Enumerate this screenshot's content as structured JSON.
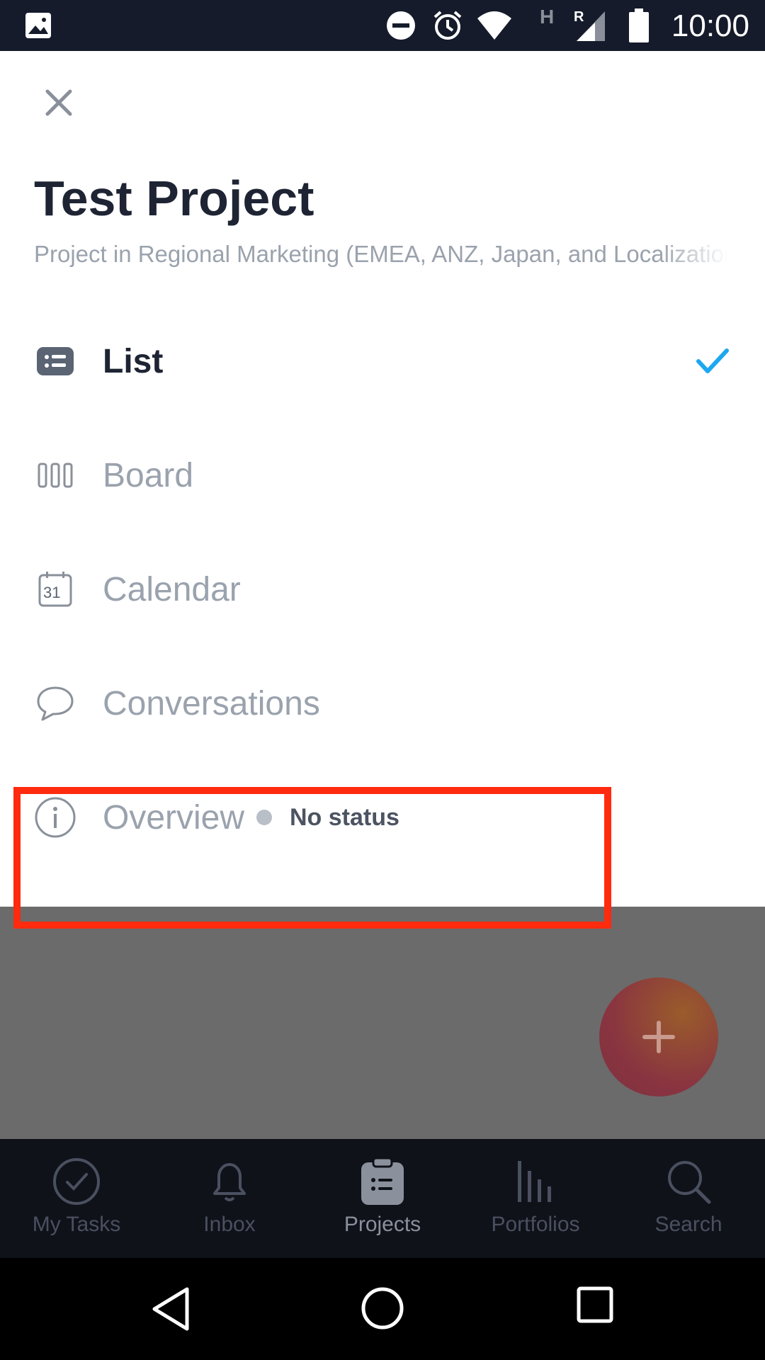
{
  "status_bar": {
    "time": "10:00"
  },
  "sheet": {
    "title": "Test Project",
    "subtitle": "Project in Regional Marketing (EMEA, ANZ, Japan, and Localization)",
    "menu": [
      {
        "label": "List",
        "icon": "list-icon",
        "active": true
      },
      {
        "label": "Board",
        "icon": "board-icon",
        "active": false
      },
      {
        "label": "Calendar",
        "icon": "calendar-icon",
        "calendar_day": "31",
        "active": false
      },
      {
        "label": "Conversations",
        "icon": "conversation-icon",
        "active": false
      },
      {
        "label": "Overview",
        "icon": "info-icon",
        "active": false,
        "status": "No status"
      }
    ],
    "highlight_color": "#ff2b0f",
    "check_color": "#1ea7f0"
  },
  "bottom_nav": {
    "tabs": [
      {
        "label": "My Tasks",
        "icon": "check-circle-icon"
      },
      {
        "label": "Inbox",
        "icon": "bell-icon"
      },
      {
        "label": "Projects",
        "icon": "clipboard-icon",
        "active": true
      },
      {
        "label": "Portfolios",
        "icon": "bar-chart-icon"
      },
      {
        "label": "Search",
        "icon": "search-icon"
      }
    ]
  }
}
